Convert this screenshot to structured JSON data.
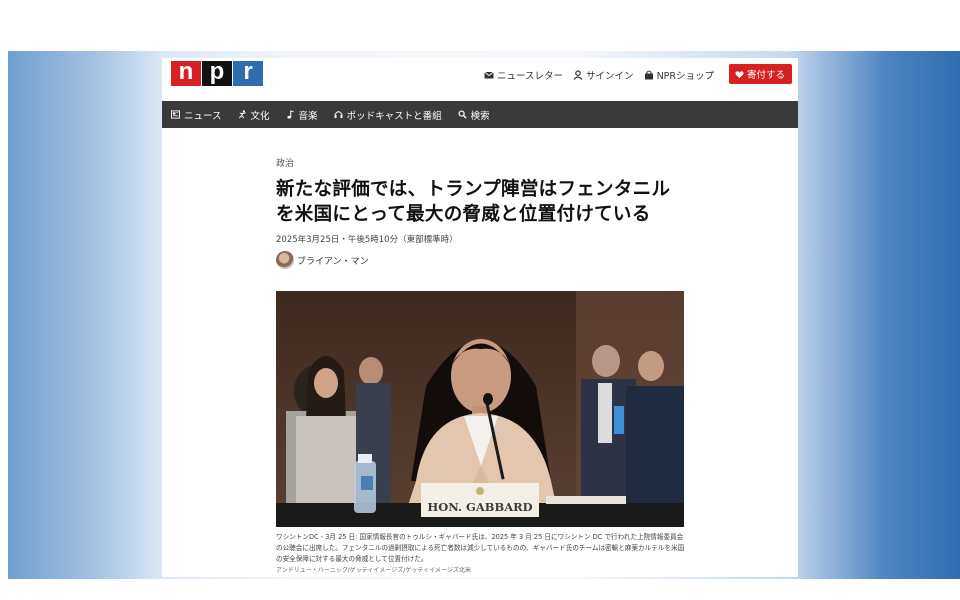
{
  "header": {
    "logo_letters": [
      "n",
      "p",
      "r"
    ],
    "links": [
      {
        "icon": "mail-icon",
        "label": "ニュースレター"
      },
      {
        "icon": "user-icon",
        "label": "サインイン"
      },
      {
        "icon": "bag-icon",
        "label": "NPRショップ"
      }
    ],
    "donate": {
      "icon": "heart-icon",
      "label": "寄付する"
    }
  },
  "nav": {
    "items": [
      {
        "icon": "newspaper-icon",
        "label": "ニュース"
      },
      {
        "icon": "dancer-icon",
        "label": "文化"
      },
      {
        "icon": "music-note-icon",
        "label": "音楽"
      },
      {
        "icon": "headphones-icon",
        "label": "ポッドキャストと番組"
      },
      {
        "icon": "search-icon",
        "label": "検索"
      }
    ]
  },
  "article": {
    "category": "政治",
    "title": "新たな評価では、トランプ陣営はフェンタニルを米国にとって最大の脅威と位置付けている",
    "date": "2025年3月25日・午後5時10分（東部標準時）",
    "author": "ブライアン・マン",
    "photo_nameplate": "HON. GABBARD",
    "caption": "ワシントンDC - 3月 25 日: 国家情報長官のトゥルシ・ギャバード氏は、2025 年 3 月 25 日にワシントン DC で行われた上院情報委員会の公聴会に出席した。フェンタニルの過剰摂取による死亡者数は減少しているものの、ギャバード氏のチームは密輸と麻薬カルテルを米国の安全保障に対する最大の脅威として位置付けた。",
    "credit": "アンドリュー・ハーニック/ゲッティイメージズ/ゲッティイメージズ北米"
  },
  "colors": {
    "brand_red": "#d62021",
    "brand_blue": "#2f6db0",
    "nav_bg": "#3a3a3a"
  }
}
